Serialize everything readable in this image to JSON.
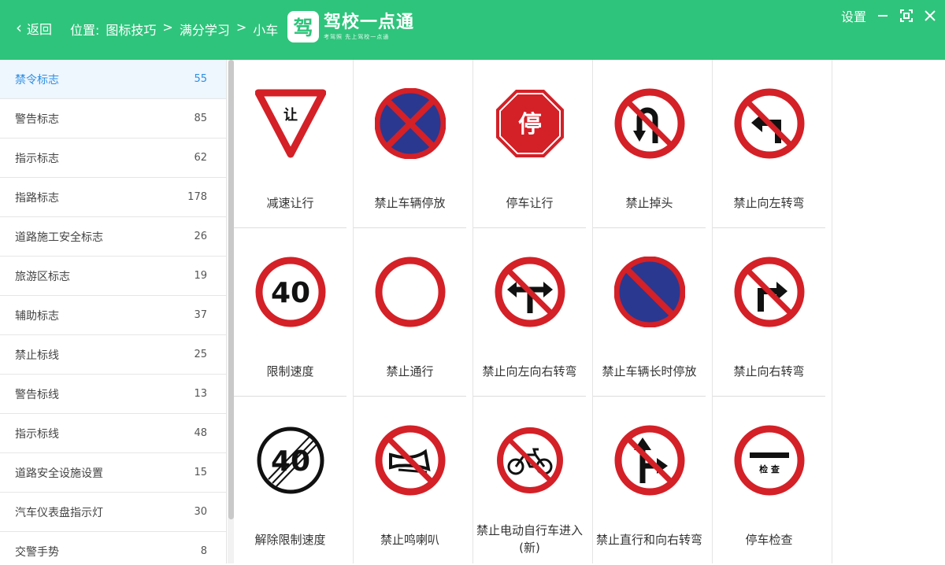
{
  "header": {
    "back_label": "返回",
    "breadcrumb": [
      "位置:",
      "图标技巧",
      ">",
      "满分学习",
      ">",
      "小车"
    ],
    "logo_mark": "驾",
    "logo_name": "驾校一点通",
    "logo_slogan": "考驾照 先上驾校一点通",
    "settings_label": "设置"
  },
  "sidebar": {
    "items": [
      {
        "label": "禁令标志",
        "count": "55"
      },
      {
        "label": "警告标志",
        "count": "85"
      },
      {
        "label": "指示标志",
        "count": "62"
      },
      {
        "label": "指路标志",
        "count": "178"
      },
      {
        "label": "道路施工安全标志",
        "count": "26"
      },
      {
        "label": "旅游区标志",
        "count": "19"
      },
      {
        "label": "辅助标志",
        "count": "37"
      },
      {
        "label": "禁止标线",
        "count": "25"
      },
      {
        "label": "警告标线",
        "count": "13"
      },
      {
        "label": "指示标线",
        "count": "48"
      },
      {
        "label": "道路安全设施设置",
        "count": "15"
      },
      {
        "label": "汽车仪表盘指示灯",
        "count": "30"
      },
      {
        "label": "交警手势",
        "count": "8"
      }
    ]
  },
  "signs": [
    {
      "caption": "减速让行",
      "icon": "yield-sign-icon",
      "text": "让"
    },
    {
      "caption": "禁止车辆停放",
      "icon": "no-parking-icon"
    },
    {
      "caption": "停车让行",
      "icon": "stop-sign-icon",
      "text": "停"
    },
    {
      "caption": "禁止掉头",
      "icon": "no-u-turn-icon"
    },
    {
      "caption": "禁止向左转弯",
      "icon": "no-left-turn-icon"
    },
    {
      "caption": "限制速度",
      "icon": "speed-limit-icon",
      "text": "40"
    },
    {
      "caption": "禁止通行",
      "icon": "no-entry-icon"
    },
    {
      "caption": "禁止向左向右转弯",
      "icon": "no-left-right-turn-icon"
    },
    {
      "caption": "禁止车辆长时停放",
      "icon": "no-long-parking-icon"
    },
    {
      "caption": "禁止向右转弯",
      "icon": "no-right-turn-icon"
    },
    {
      "caption": "解除限制速度",
      "icon": "end-speed-limit-icon",
      "text": "40"
    },
    {
      "caption": "禁止鸣喇叭",
      "icon": "no-horn-icon"
    },
    {
      "caption": "禁止电动自行车进入(新)",
      "icon": "no-ebike-icon"
    },
    {
      "caption": "禁止直行和向右转弯",
      "icon": "no-straight-right-icon"
    },
    {
      "caption": "停车检查",
      "icon": "stop-check-icon",
      "text": "检 查"
    }
  ],
  "colors": {
    "brand": "#2ec47b",
    "active": "#2b8fe4",
    "red": "#d42027",
    "blue": "#2a3890"
  }
}
